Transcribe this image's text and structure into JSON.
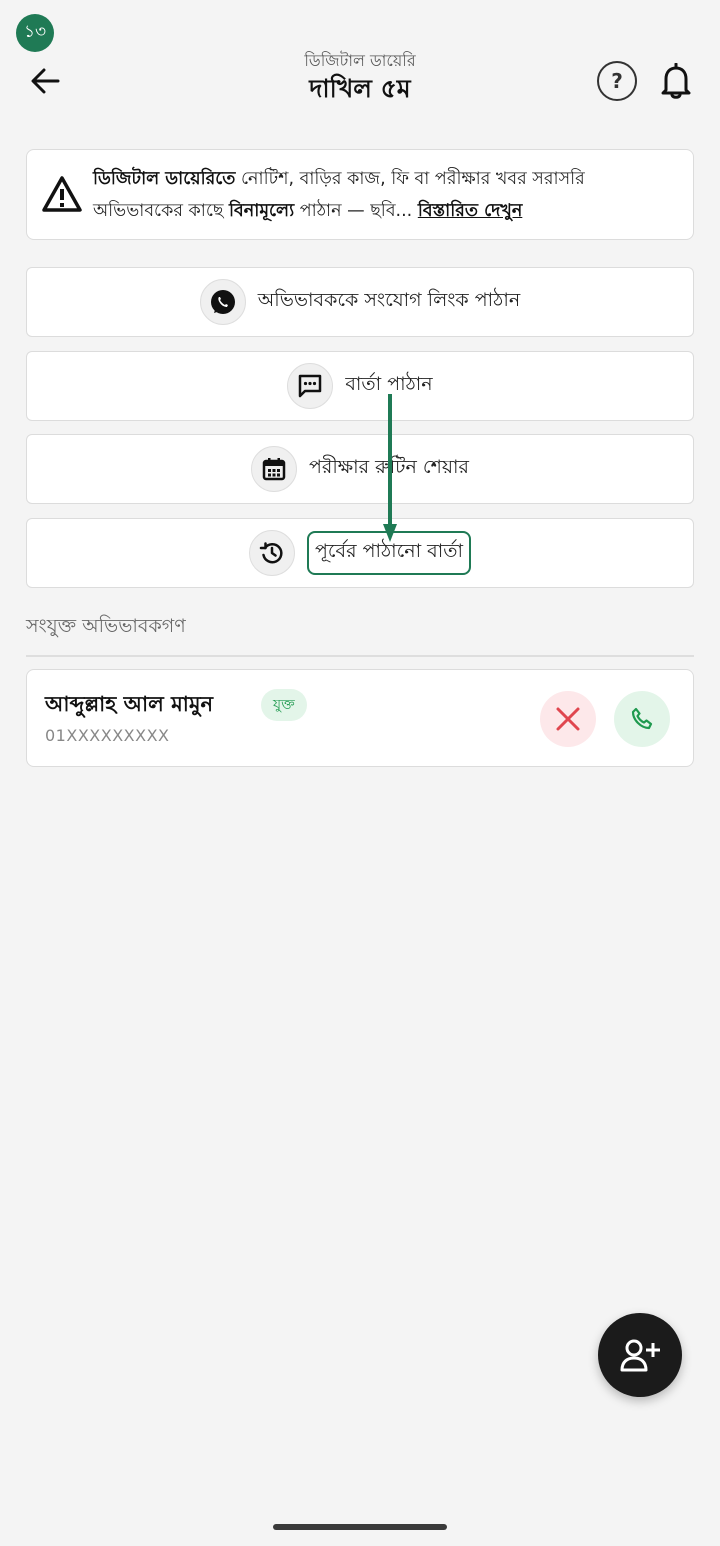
{
  "step_badge": "১৩",
  "header": {
    "subtitle": "ডিজিটাল ডায়েরি",
    "title": "দাখিল ৫ম",
    "help_label": "?"
  },
  "notice": {
    "bold_lead": "ডিজিটাল ডায়েরিতে",
    "text_1": " নোটিশ, বাড়ির কাজ, ফি বা পরীক্ষার খবর সরাসরি অভিভাবকের কাছে ",
    "bold_mid": "বিনামূল্যে",
    "text_2": " পাঠান — ছবি... ",
    "link": "বিস্তারিত দেখুন"
  },
  "actions": [
    {
      "label": "অভিভাবককে সংযোগ লিংক পাঠান",
      "icon": "whatsapp-icon"
    },
    {
      "label": "বার্তা পাঠান",
      "icon": "message-icon"
    },
    {
      "label": "পরীক্ষার রুটিন শেয়ার",
      "icon": "calendar-icon"
    },
    {
      "label": "পূর্বের পাঠানো বার্তা",
      "icon": "history-icon"
    }
  ],
  "guardians_section": {
    "label": "সংযুক্ত অভিভাবকগণ",
    "items": [
      {
        "name": "আব্দুল্লাহ আল মামুন",
        "status": "যুক্ত",
        "phone": "01XXXXXXXXX"
      }
    ]
  },
  "colors": {
    "accent": "#1f7a55",
    "status_green": "#1f9a4f",
    "danger": "#e0464f",
    "fab": "#1b1b1b"
  }
}
